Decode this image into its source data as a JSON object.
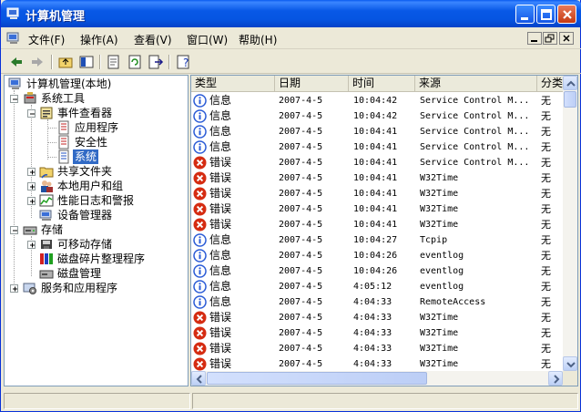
{
  "window": {
    "title": "计算机管理"
  },
  "menu": [
    "文件(F)",
    "操作(A)",
    "查看(V)",
    "窗口(W)",
    "帮助(H)"
  ],
  "tree": [
    {
      "label": "计算机管理(本地)",
      "icon": "computer-management-icon"
    },
    {
      "label": "系统工具",
      "icon": "system-tools-icon"
    },
    {
      "label": "事件查看器",
      "icon": "event-viewer-icon"
    },
    {
      "label": "应用程序",
      "icon": "log-icon"
    },
    {
      "label": "安全性",
      "icon": "log-icon"
    },
    {
      "label": "系统",
      "icon": "log-icon"
    },
    {
      "label": "共享文件夹",
      "icon": "shared-folder-icon"
    },
    {
      "label": "本地用户和组",
      "icon": "users-icon"
    },
    {
      "label": "性能日志和警报",
      "icon": "performance-icon"
    },
    {
      "label": "设备管理器",
      "icon": "device-manager-icon"
    },
    {
      "label": "存储",
      "icon": "storage-icon"
    },
    {
      "label": "可移动存储",
      "icon": "removable-storage-icon"
    },
    {
      "label": "磁盘碎片整理程序",
      "icon": "defrag-icon"
    },
    {
      "label": "磁盘管理",
      "icon": "disk-management-icon"
    },
    {
      "label": "服务和应用程序",
      "icon": "services-icon"
    }
  ],
  "columns": [
    "类型",
    "日期",
    "时间",
    "来源",
    "分类"
  ],
  "rows": [
    {
      "type": "信息",
      "kind": "info",
      "date": "2007-4-5",
      "time": "10:04:42",
      "source": "Service Control M...",
      "category": "无"
    },
    {
      "type": "信息",
      "kind": "info",
      "date": "2007-4-5",
      "time": "10:04:42",
      "source": "Service Control M...",
      "category": "无"
    },
    {
      "type": "信息",
      "kind": "info",
      "date": "2007-4-5",
      "time": "10:04:41",
      "source": "Service Control M...",
      "category": "无"
    },
    {
      "type": "信息",
      "kind": "info",
      "date": "2007-4-5",
      "time": "10:04:41",
      "source": "Service Control M...",
      "category": "无"
    },
    {
      "type": "错误",
      "kind": "error",
      "date": "2007-4-5",
      "time": "10:04:41",
      "source": "Service Control M...",
      "category": "无"
    },
    {
      "type": "错误",
      "kind": "error",
      "date": "2007-4-5",
      "time": "10:04:41",
      "source": "W32Time",
      "category": "无"
    },
    {
      "type": "错误",
      "kind": "error",
      "date": "2007-4-5",
      "time": "10:04:41",
      "source": "W32Time",
      "category": "无"
    },
    {
      "type": "错误",
      "kind": "error",
      "date": "2007-4-5",
      "time": "10:04:41",
      "source": "W32Time",
      "category": "无"
    },
    {
      "type": "错误",
      "kind": "error",
      "date": "2007-4-5",
      "time": "10:04:41",
      "source": "W32Time",
      "category": "无"
    },
    {
      "type": "信息",
      "kind": "info",
      "date": "2007-4-5",
      "time": "10:04:27",
      "source": "Tcpip",
      "category": "无"
    },
    {
      "type": "信息",
      "kind": "info",
      "date": "2007-4-5",
      "time": "10:04:26",
      "source": "eventlog",
      "category": "无"
    },
    {
      "type": "信息",
      "kind": "info",
      "date": "2007-4-5",
      "time": "10:04:26",
      "source": "eventlog",
      "category": "无"
    },
    {
      "type": "信息",
      "kind": "info",
      "date": "2007-4-5",
      "time": "4:05:12",
      "source": "eventlog",
      "category": "无"
    },
    {
      "type": "信息",
      "kind": "info",
      "date": "2007-4-5",
      "time": "4:04:33",
      "source": "RemoteAccess",
      "category": "无"
    },
    {
      "type": "错误",
      "kind": "error",
      "date": "2007-4-5",
      "time": "4:04:33",
      "source": "W32Time",
      "category": "无"
    },
    {
      "type": "错误",
      "kind": "error",
      "date": "2007-4-5",
      "time": "4:04:33",
      "source": "W32Time",
      "category": "无"
    },
    {
      "type": "错误",
      "kind": "error",
      "date": "2007-4-5",
      "time": "4:04:33",
      "source": "W32Time",
      "category": "无"
    },
    {
      "type": "错误",
      "kind": "error",
      "date": "2007-4-5",
      "time": "4:04:33",
      "source": "W32Time",
      "category": "无"
    }
  ],
  "colors": {
    "titlebar": "#0858e6",
    "selection": "#316ac5",
    "error": "#d52c12",
    "info": "#2a5bd6"
  }
}
